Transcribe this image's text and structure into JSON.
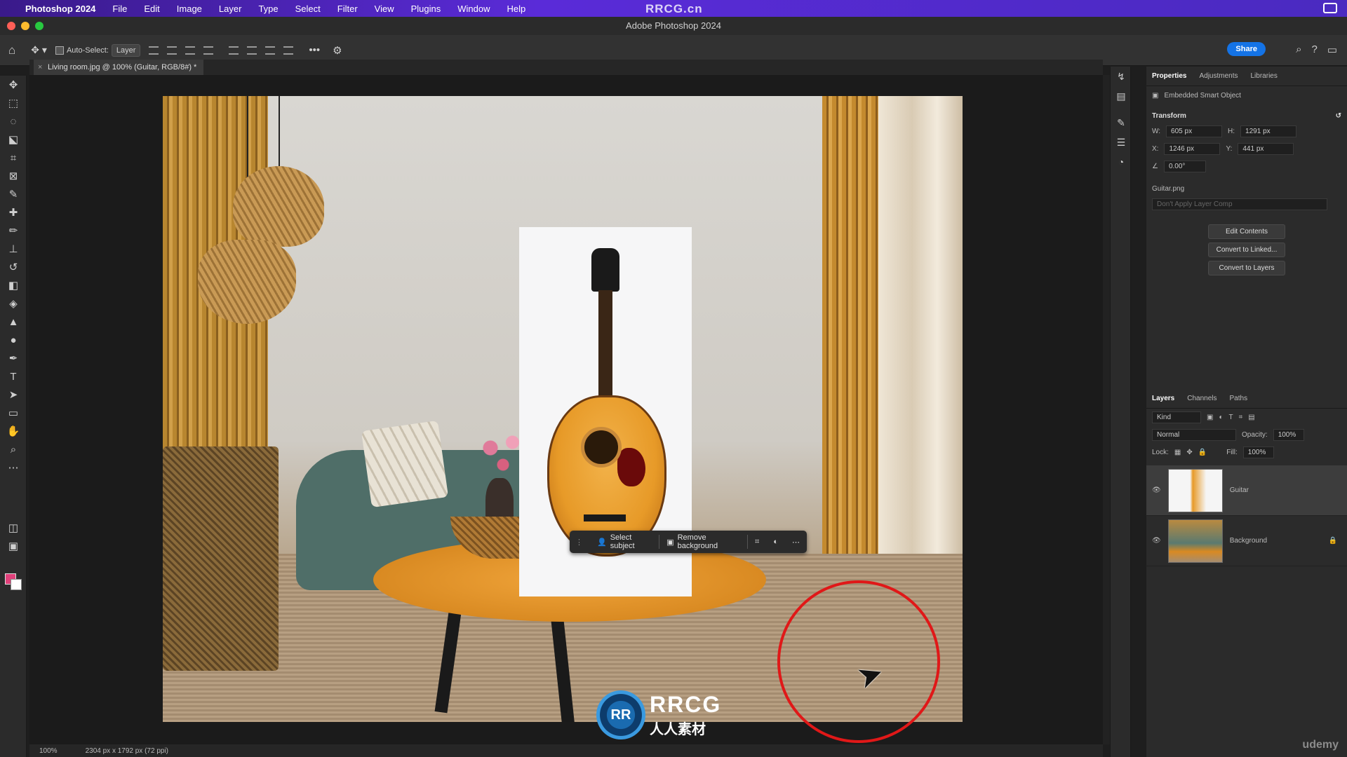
{
  "menubar": {
    "app": "Photoshop 2024",
    "items": [
      "File",
      "Edit",
      "Image",
      "Layer",
      "Type",
      "Select",
      "Filter",
      "View",
      "Plugins",
      "Window",
      "Help"
    ],
    "brand": "RRCG.cn"
  },
  "window": {
    "title": "Adobe Photoshop 2024"
  },
  "options": {
    "auto_select_label": "Auto-Select:",
    "auto_select_value": "Layer",
    "share_label": "Share"
  },
  "document": {
    "tab_title": "Living room.jpg @ 100% (Guitar, RGB/8#) *"
  },
  "context_bar": {
    "select_subject": "Select subject",
    "remove_background": "Remove background"
  },
  "status": {
    "zoom": "100%",
    "dimensions": "2304 px x 1792 px (72 ppi)"
  },
  "properties": {
    "tabs": [
      "Properties",
      "Adjustments",
      "Libraries"
    ],
    "object_type": "Embedded Smart Object",
    "transform_label": "Transform",
    "w": "605 px",
    "h": "1291 px",
    "x": "1246 px",
    "y": "441 px",
    "angle": "0.00°",
    "file_name": "Guitar.png",
    "layer_comp": "Don't Apply Layer Comp",
    "buttons": [
      "Edit Contents",
      "Convert to Linked...",
      "Convert to Layers"
    ]
  },
  "layers": {
    "tabs": [
      "Layers",
      "Channels",
      "Paths"
    ],
    "kind_label": "Kind",
    "blend_mode": "Normal",
    "opacity_label": "Opacity:",
    "opacity": "100%",
    "lock_label": "Lock:",
    "fill_label": "Fill:",
    "fill": "100%",
    "items": [
      {
        "name": "Guitar"
      },
      {
        "name": "Background"
      }
    ]
  },
  "watermark": {
    "logo_text": "RRCG",
    "sub_text": "人人素材",
    "footer": "udemy"
  },
  "colors": {
    "accent": "#1473e6",
    "highlight_ring": "#e01818",
    "menubar": "#4a2ac0"
  }
}
